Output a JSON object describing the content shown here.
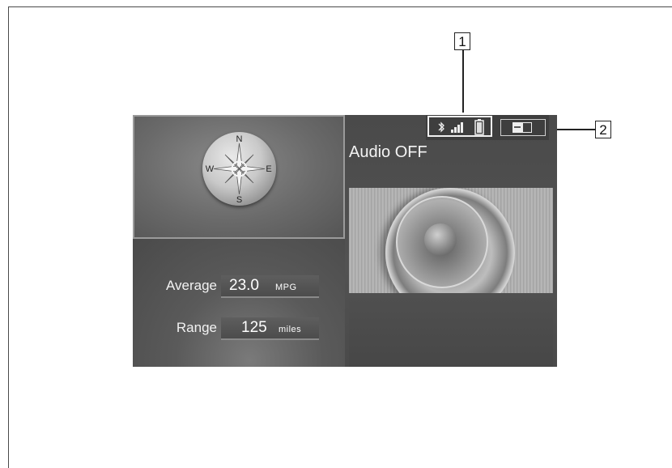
{
  "callouts": {
    "one": "1",
    "two": "2"
  },
  "compass": {
    "north": "N",
    "south": "S",
    "east": "E",
    "west": "W"
  },
  "trip": {
    "average_label": "Average",
    "average_value": "23.0",
    "average_unit": "MPG",
    "range_label": "Range",
    "range_value": "125",
    "range_unit": "miles"
  },
  "audio": {
    "status_text": "Audio OFF"
  },
  "status_icons": [
    "bluetooth-icon",
    "signal-strength-icon",
    "battery-icon"
  ],
  "menu_icon": "screen-layout-icon",
  "colors": {
    "screen_bg": "#444444",
    "text": "#f2f2f2",
    "callout_border": "#222222"
  }
}
